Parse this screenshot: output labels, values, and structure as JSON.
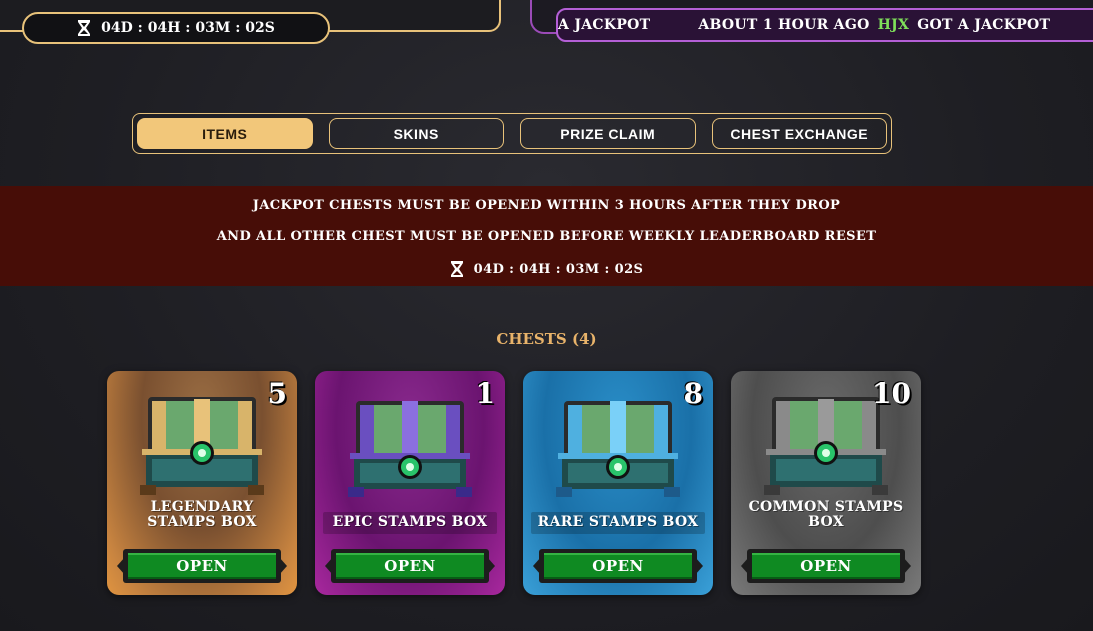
{
  "header": {
    "timer": "04D : 04H : 03M : 02S",
    "ticker": [
      {
        "text": "A JACKPOT",
        "user": ""
      },
      {
        "text": "ABOUT 1 HOUR AGO",
        "user": "HJX"
      },
      {
        "text": "GOT A JACKPOT",
        "user": ""
      },
      {
        "text": "A",
        "user": ""
      }
    ]
  },
  "tabs": [
    {
      "label": "ITEMS",
      "active": true
    },
    {
      "label": "SKINS",
      "active": false
    },
    {
      "label": "PRIZE CLAIM",
      "active": false
    },
    {
      "label": "CHEST EXCHANGE",
      "active": false
    }
  ],
  "notice": {
    "line1": "JACKPOT CHESTS MUST BE OPENED WITHIN 3 HOURS AFTER THEY DROP",
    "line2": "AND ALL OTHER CHEST MUST BE OPENED BEFORE WEEKLY LEADERBOARD RESET",
    "timer": "04D : 04H : 03M : 02S"
  },
  "chests": {
    "title": "CHESTS (4)",
    "items": [
      {
        "name": "LEGENDARY STAMPS BOX",
        "count": "5",
        "open_label": "OPEN",
        "accent": "#e2b36a"
      },
      {
        "name": "EPIC STAMPS BOX",
        "count": "1",
        "open_label": "OPEN",
        "accent": "#7b4fd1"
      },
      {
        "name": "RARE STAMPS BOX",
        "count": "8",
        "open_label": "OPEN",
        "accent": "#5cc4f0"
      },
      {
        "name": "COMMON STAMPS BOX",
        "count": "10",
        "open_label": "OPEN",
        "accent": "#8a8a8a"
      }
    ]
  },
  "colors": {
    "gold_border": "#e8c27a",
    "notice_bg": "#470d07",
    "open_green": "#0f8a22",
    "ticker_user": "#7fe05a"
  }
}
